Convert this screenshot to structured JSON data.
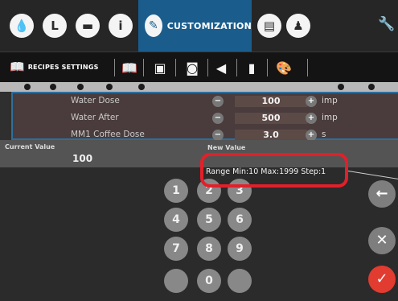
{
  "topbar": {
    "icons": [
      "water-drop-icon",
      "clock-icon",
      "folder-icon",
      "info-icon"
    ],
    "icons_glyphs": [
      "💧",
      "L",
      "▬",
      "i"
    ],
    "active_tab": "CUSTOMIZATION",
    "after_icons": [
      "list-icon",
      "person-icon"
    ],
    "after_glyphs": [
      "▤",
      "♟"
    ],
    "wrench_glyph": "🔧"
  },
  "subbar": {
    "recipes_label": "RECIPES SETTINGS",
    "icons": [
      "book-icon",
      "screen-icon",
      "photo-icon",
      "speaker-icon",
      "usb-icon",
      "palette-icon"
    ],
    "glyphs": [
      "📖",
      "▣",
      "◙",
      "◀",
      "▮",
      "🎨"
    ]
  },
  "settings": [
    {
      "name": "Water Dose",
      "value": "100",
      "unit": "imp"
    },
    {
      "name": "Water After",
      "value": "500",
      "unit": "imp"
    },
    {
      "name": "MM1 Coffee Dose",
      "value": "3.0",
      "unit": "s"
    }
  ],
  "editor": {
    "current_label": "Current Value",
    "current_value": "100",
    "new_label": "New Value",
    "range_text": "Range Min:10 Max:1999 Step:1"
  },
  "keypad": {
    "keys": [
      "1",
      "2",
      "3",
      "4",
      "5",
      "6",
      "7",
      "8",
      "9",
      "",
      "0",
      ""
    ],
    "back": "←",
    "clear": "✕",
    "ok": "✓"
  },
  "colors": {
    "active_tab": "#1a5d8d",
    "highlight": "#e2202a",
    "confirm": "#e23b30"
  }
}
